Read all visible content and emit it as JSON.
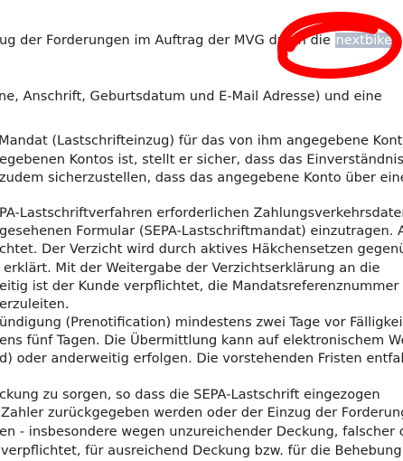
{
  "document": {
    "lines": [
      {
        "pre": "ug der Forderungen im Auftrag der MVG durch die ",
        "hl": "nextbike",
        "post": ""
      },
      {
        "pre": "",
        "hl": "",
        "post": ""
      },
      {
        "pre": "ne, Anschrift, Geburtsdatum und E-Mail Adresse) und eine",
        "hl": "",
        "post": ""
      },
      {
        "pre": "",
        "hl": "",
        "post": ""
      },
      {
        "pre": "Mandat (Lastschrifteinzug) für das von ihm angegebene Konto.",
        "hl": "",
        "post": ""
      },
      {
        "pre": "egebenen Kontos ist, stellt er sicher, dass das Einverständnis des",
        "hl": "",
        "post": ""
      },
      {
        "pre": "zudem sicherzustellen, dass das angegebene Konto über eine",
        "hl": "",
        "post": ""
      },
      {
        "pre": "",
        "hl": "",
        "post": ""
      },
      {
        "pre": "PA-Lastschriftverfahren erforderlichen Zahlungsverkehrsdaten",
        "hl": "",
        "post": ""
      },
      {
        "pre": "gesehenen Formular (SEPA-Lastschriftmandat) einzutragen. Auf",
        "hl": "",
        "post": ""
      },
      {
        "pre": "chtet. Der Verzicht wird durch aktives Häkchensetzen gegenüber",
        "hl": "",
        "post": ""
      },
      {
        "pre": "erklärt. Mit der Weitergabe der Verzichtserklärung an die",
        "hl": "",
        "post": ""
      },
      {
        "pre": "eitig ist der Kunde verpflichtet, die Mandatsreferenznummer –",
        "hl": "",
        "post": ""
      },
      {
        "pre": "erzuleiten.",
        "hl": "",
        "post": ""
      },
      {
        "pre": "ündigung (Prenotification) mindestens zwei Tage vor Fälligkeit",
        "hl": "",
        "post": ""
      },
      {
        "pre": "ens fünf Tagen. Die Übermittlung kann auf elektronischem Wege",
        "hl": "",
        "post": ""
      },
      {
        "pre": "d) oder anderweitig erfolgen. Die vorstehenden Fristen entfallen",
        "hl": "",
        "post": ""
      },
      {
        "pre": "",
        "hl": "",
        "post": ""
      },
      {
        "pre": "ckung zu sorgen, so dass die SEPA-Lastschrift eingezogen",
        "hl": "",
        "post": ""
      },
      {
        "pre": "Zahler zurückgegeben werden oder der Einzug der Forderung",
        "hl": "",
        "post": ""
      },
      {
        "pre": "en - insbesondere wegen unzureichender Deckung, falscher oder",
        "hl": "",
        "post": ""
      },
      {
        "pre": "verpflichtet, für ausreichend Deckung bzw. für die Behebung",
        "hl": "",
        "post": ""
      }
    ]
  },
  "annotation": {
    "shape": "hand-drawn-ellipse",
    "color": "#ff0000"
  },
  "colors": {
    "text": "#222222",
    "highlight_background": "#b3bccb",
    "highlight_text": "#ffffff",
    "background": "#ffffff"
  }
}
